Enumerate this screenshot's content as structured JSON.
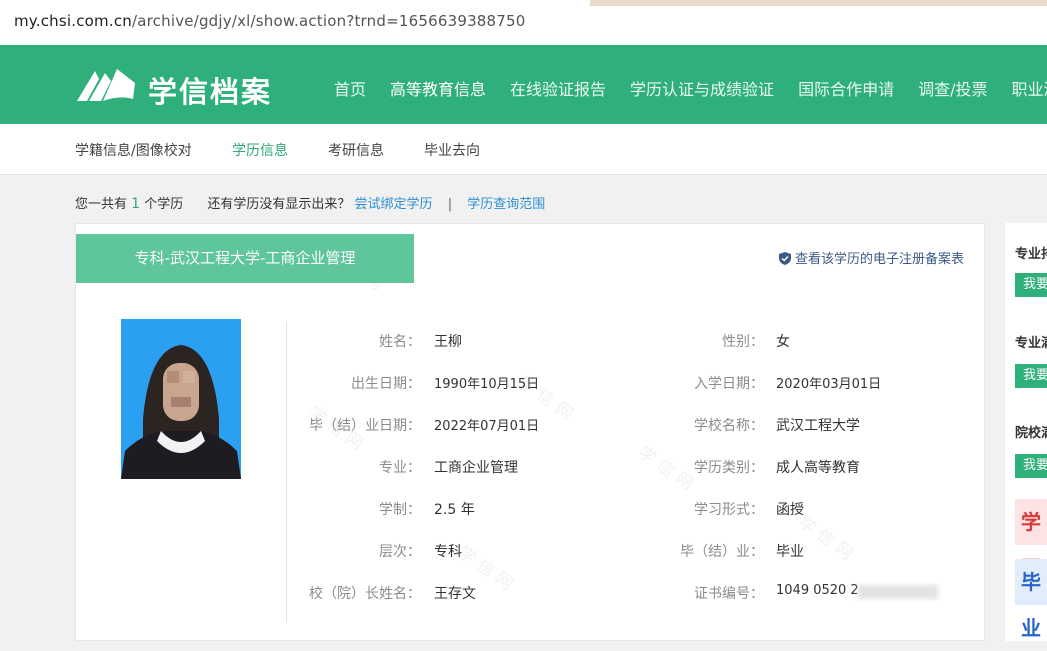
{
  "browser": {
    "url_host": "my.chsi.com.cn",
    "url_path": "/archive/gdjy/xl/show.action?trnd=1656639388750"
  },
  "header": {
    "brand": "学信档案",
    "nav": [
      "首页",
      "高等教育信息",
      "在线验证报告",
      "学历认证与成绩验证",
      "国际合作申请",
      "调查/投票",
      "职业测评"
    ]
  },
  "subnav": [
    "学籍信息/图像校对",
    "学历信息",
    "考研信息",
    "毕业去向"
  ],
  "info": {
    "prefix": "您一共有",
    "count": "1",
    "suffix": "个学历",
    "question": "还有学历没有显示出来？",
    "bind_link": "尝试绑定学历",
    "sep": "|",
    "scope_link": "学历查询范围"
  },
  "record": {
    "title": "专科-武汉工程大学-工商企业管理",
    "register_link": "查看该学历的电子注册备案表",
    "left_fields": [
      {
        "label": "姓名：",
        "value": "王柳"
      },
      {
        "label": "出生日期：",
        "value": "1990年10月15日"
      },
      {
        "label": "毕（结）业日期：",
        "value": "2022年07月01日"
      },
      {
        "label": "专业：",
        "value": "工商企业管理"
      },
      {
        "label": "学制：",
        "value": "2.5 年"
      },
      {
        "label": "层次：",
        "value": "专科"
      },
      {
        "label": "校（院）长姓名：",
        "value": "王存文"
      }
    ],
    "right_fields": [
      {
        "label": "性别：",
        "value": "女"
      },
      {
        "label": "入学日期：",
        "value": "2020年03月01日"
      },
      {
        "label": "学校名称：",
        "value": "武汉工程大学"
      },
      {
        "label": "学历类别：",
        "value": "成人高等教育"
      },
      {
        "label": "学习形式：",
        "value": "函授"
      },
      {
        "label": "毕（结）业：",
        "value": "毕业"
      },
      {
        "label": "证书编号：",
        "value": "1049 0520 2"
      }
    ]
  },
  "sidebar": {
    "titles": [
      "专业排",
      "专业满",
      "院校满"
    ],
    "button": "我要",
    "promo1": "学历",
    "promo2": "毕业"
  },
  "colors": {
    "brand_green": "#2fb07a",
    "tag_green": "#5ec69a",
    "link_blue": "#2e8fcf"
  }
}
